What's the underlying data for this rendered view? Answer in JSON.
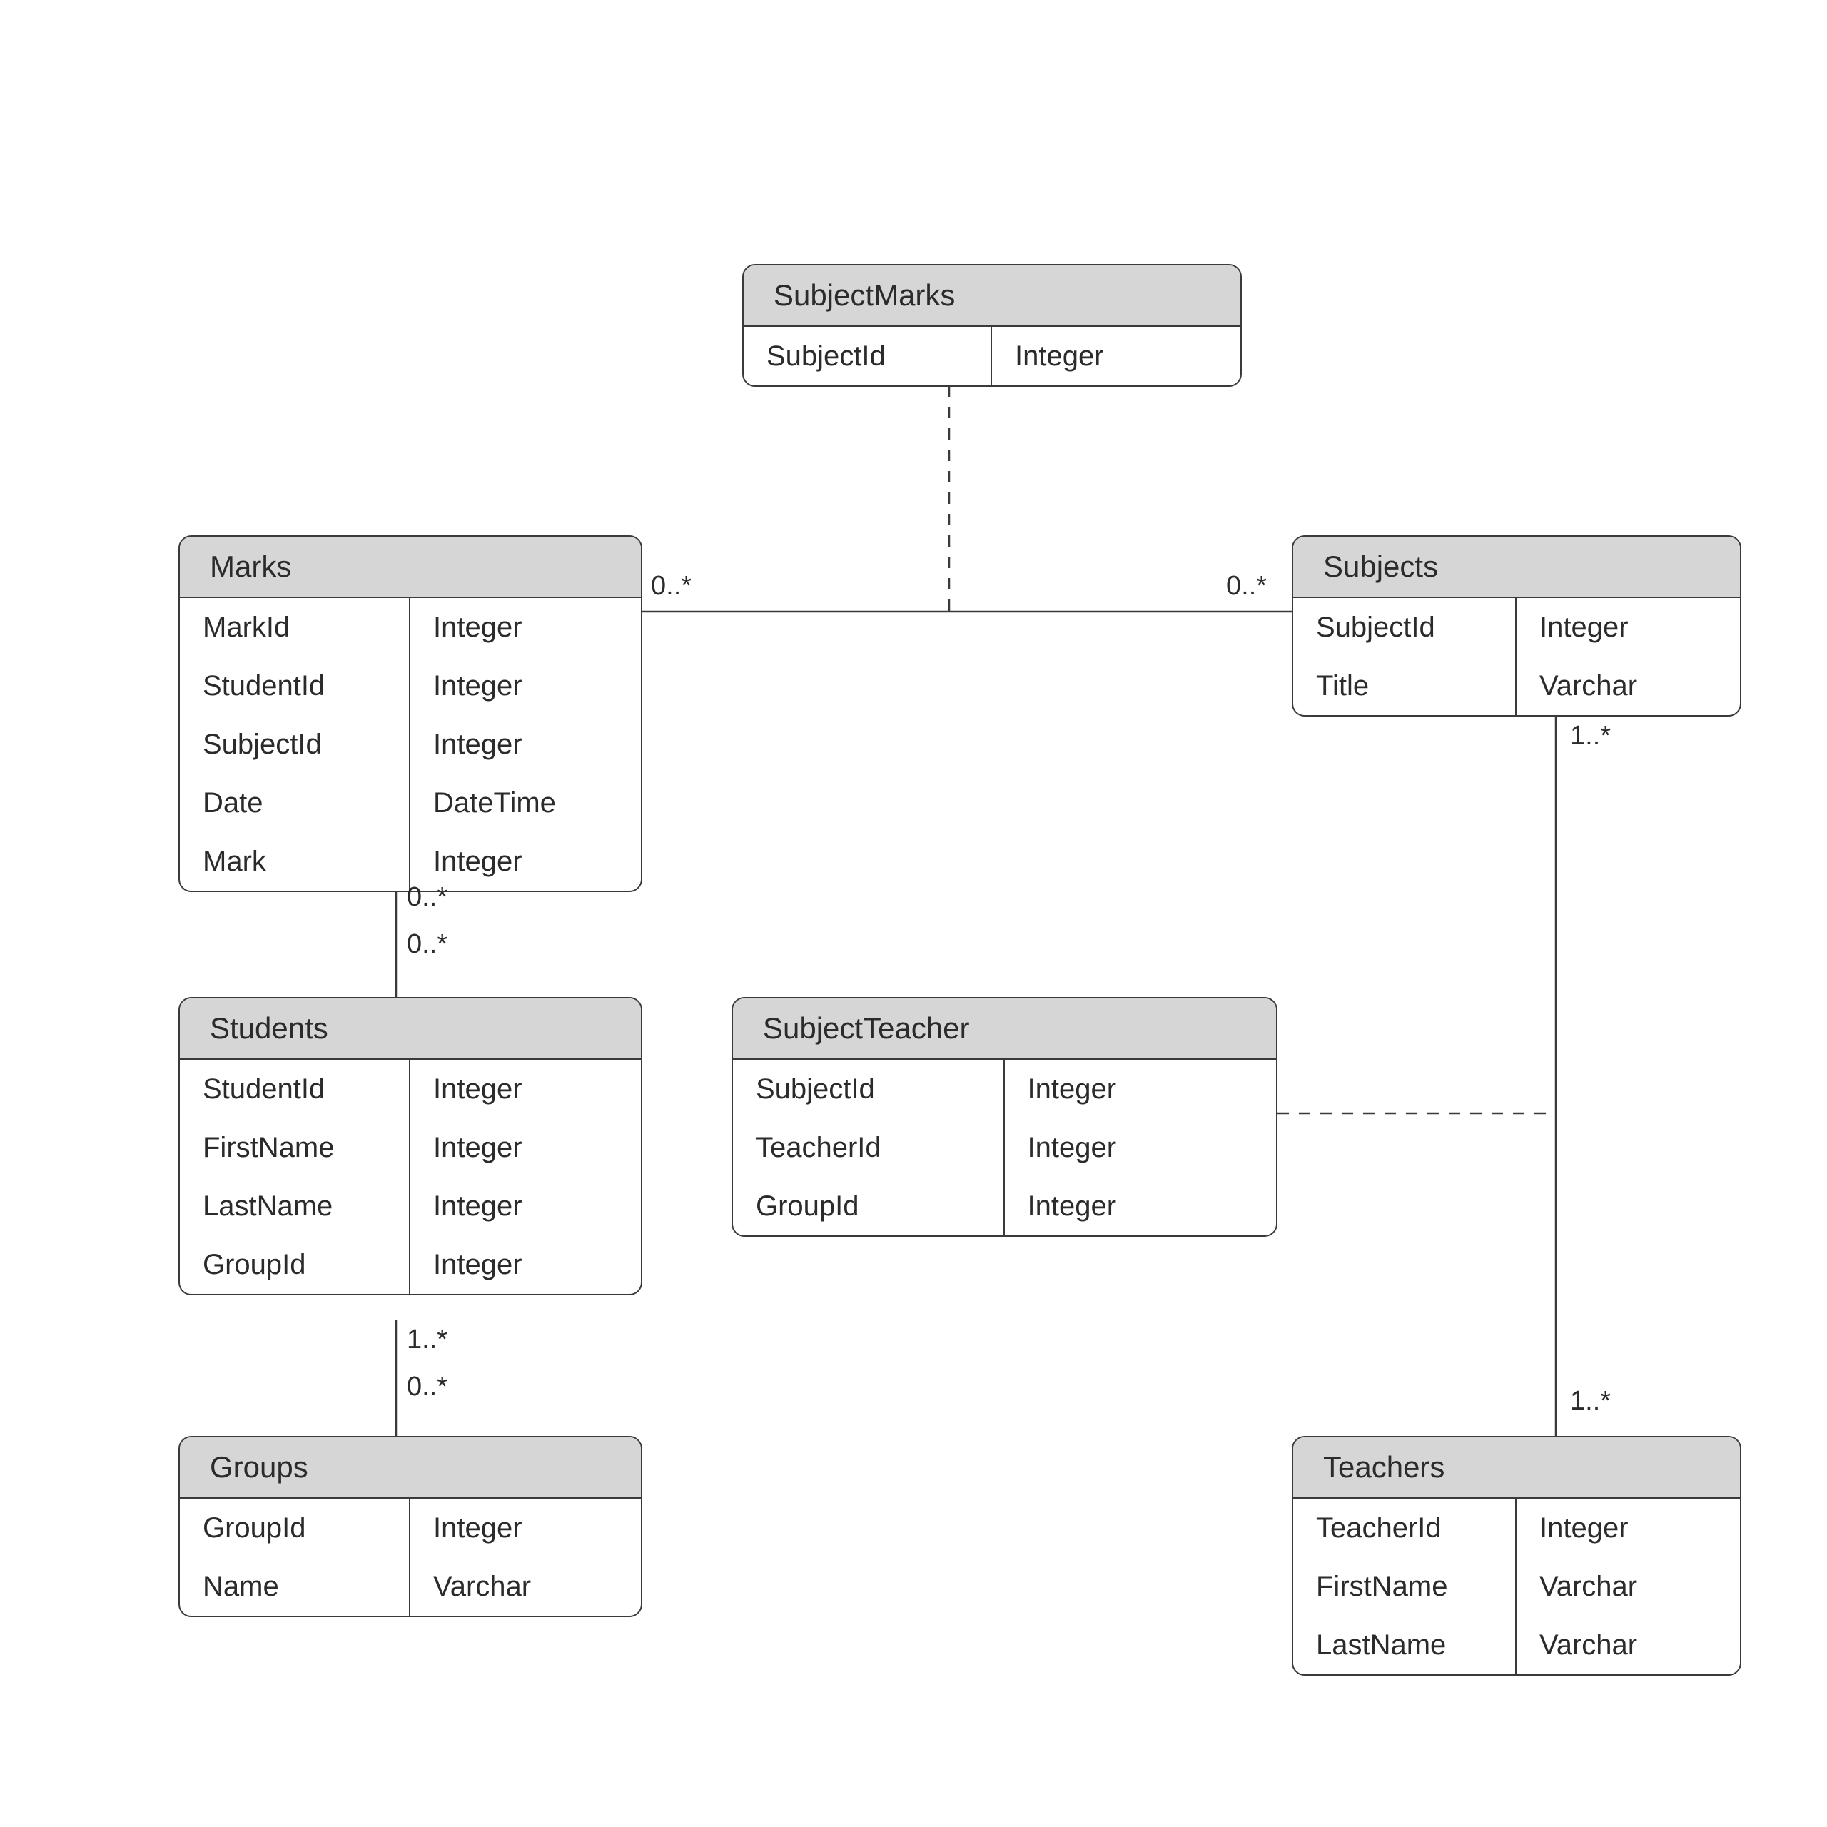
{
  "entities": {
    "subjectMarks": {
      "title": "SubjectMarks",
      "rows": [
        {
          "name": "SubjectId",
          "type": "Integer"
        }
      ]
    },
    "marks": {
      "title": "Marks",
      "rows": [
        {
          "name": "MarkId",
          "type": "Integer"
        },
        {
          "name": "StudentId",
          "type": "Integer"
        },
        {
          "name": "SubjectId",
          "type": "Integer"
        },
        {
          "name": "Date",
          "type": "DateTime"
        },
        {
          "name": "Mark",
          "type": "Integer"
        }
      ]
    },
    "subjects": {
      "title": "Subjects",
      "rows": [
        {
          "name": "SubjectId",
          "type": "Integer"
        },
        {
          "name": "Title",
          "type": "Varchar"
        }
      ]
    },
    "students": {
      "title": "Students",
      "rows": [
        {
          "name": "StudentId",
          "type": "Integer"
        },
        {
          "name": "FirstName",
          "type": "Integer"
        },
        {
          "name": "LastName",
          "type": "Integer"
        },
        {
          "name": "GroupId",
          "type": "Integer"
        }
      ]
    },
    "subjectTeacher": {
      "title": "SubjectTeacher",
      "rows": [
        {
          "name": "SubjectId",
          "type": "Integer"
        },
        {
          "name": "TeacherId",
          "type": "Integer"
        },
        {
          "name": "GroupId",
          "type": "Integer"
        }
      ]
    },
    "groups": {
      "title": "Groups",
      "rows": [
        {
          "name": "GroupId",
          "type": "Integer"
        },
        {
          "name": "Name",
          "type": "Varchar"
        }
      ]
    },
    "teachers": {
      "title": "Teachers",
      "rows": [
        {
          "name": "TeacherId",
          "type": "Integer"
        },
        {
          "name": "FirstName",
          "type": "Varchar"
        },
        {
          "name": "LastName",
          "type": "Varchar"
        }
      ]
    }
  },
  "multiplicities": {
    "marksRight": "0..*",
    "subjectsLeft": "0..*",
    "marksBottom": "0..*",
    "studentsTop": "0..*",
    "studentsBottom": "1..*",
    "groupsTop": "0..*",
    "subjectsBottom": "1..*",
    "teachersTop": "1..*"
  }
}
